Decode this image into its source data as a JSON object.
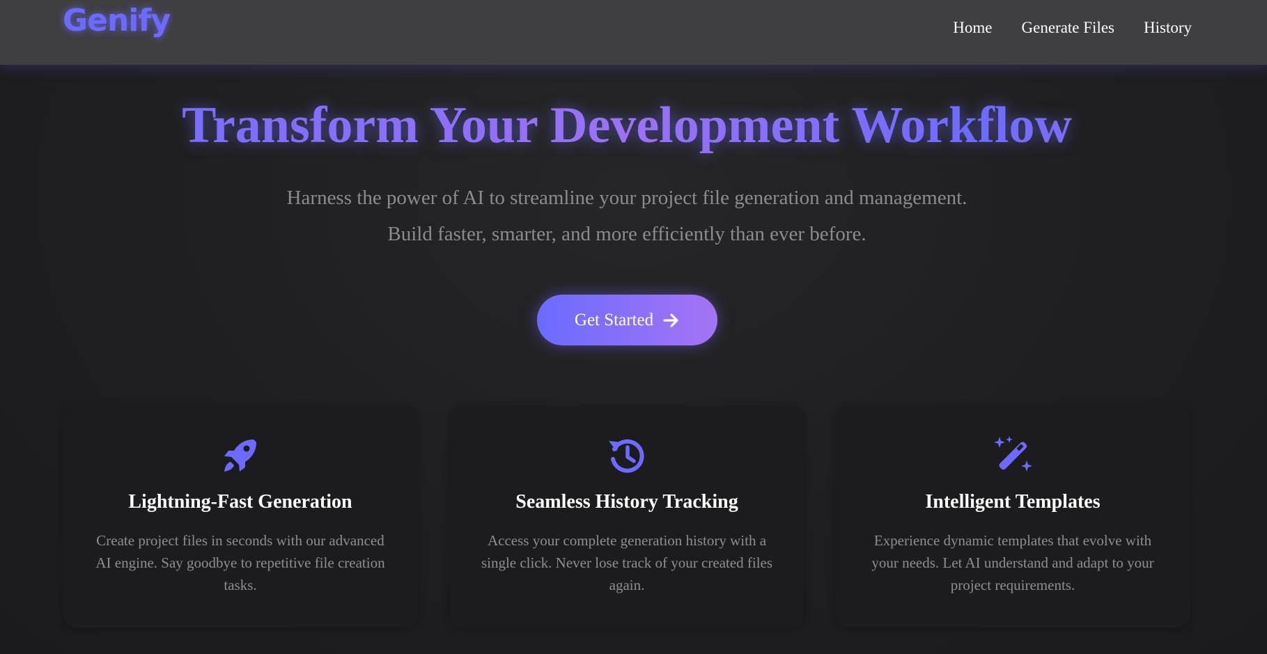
{
  "nav": {
    "logo": "Genify",
    "links": [
      "Home",
      "Generate Files",
      "History"
    ]
  },
  "hero": {
    "title": "Transform Your Development Workflow",
    "subtitle": "Harness the power of AI to streamline your project file generation and management. Build faster, smarter, and more efficiently than ever before.",
    "cta_label": "Get Started",
    "cta_icon": "arrow-right-icon"
  },
  "features": [
    {
      "icon": "rocket-icon",
      "title": "Lightning-Fast Generation",
      "text": "Create project files in seconds with our advanced AI engine. Say goodbye to repetitive file creation tasks."
    },
    {
      "icon": "history-icon",
      "title": "Seamless History Tracking",
      "text": "Access your complete generation history with a single click. Never lose track of your created files again."
    },
    {
      "icon": "magic-wand-icon",
      "title": "Intelligent Templates",
      "text": "Experience dynamic templates that evolve with your needs. Let AI understand and adapt to your project requirements."
    }
  ],
  "colors": {
    "accent": "#6d6bff",
    "accent_end": "#a574f3",
    "navbar_bg": "#3f3f42",
    "page_bg": "#1f1f21",
    "card_bg": "#1c1c1e"
  }
}
